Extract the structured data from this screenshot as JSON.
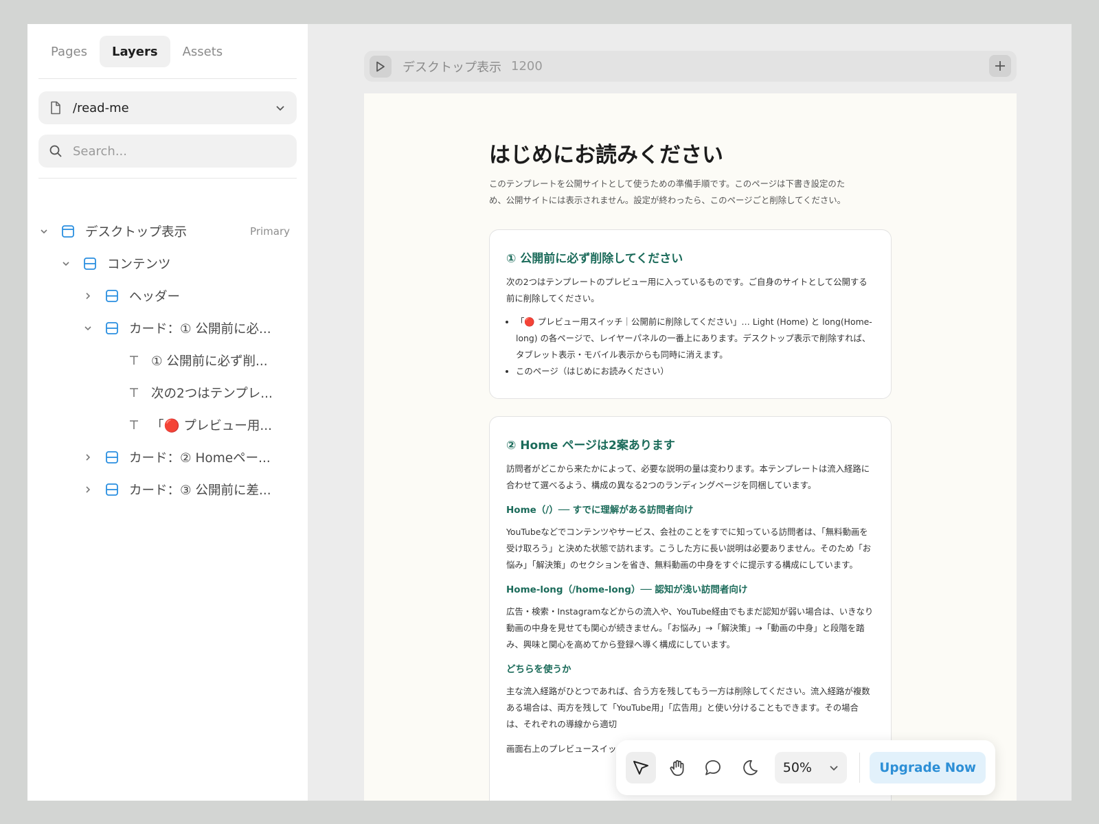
{
  "sidebar": {
    "tabs": [
      {
        "label": "Pages"
      },
      {
        "label": "Layers"
      },
      {
        "label": "Assets"
      }
    ],
    "page_select": {
      "value": "/read-me"
    },
    "search": {
      "placeholder": "Search..."
    },
    "tree": [
      {
        "label": "デスクトップ表示",
        "badge": "Primary"
      },
      {
        "label": "コンテンツ"
      },
      {
        "label": "ヘッダー"
      },
      {
        "label": "カード：① 公開前に必..."
      },
      {
        "label": "① 公開前に必ず削..."
      },
      {
        "label": "次の2つはテンプレ..."
      },
      {
        "label": "「🔴 プレビュー用..."
      },
      {
        "label": "カード：② Homeペー..."
      },
      {
        "label": "カード：③ 公開前に差..."
      }
    ]
  },
  "canvas_toolbar": {
    "frame_title": "デスクトップ表示",
    "frame_width": "1200"
  },
  "page": {
    "title": "はじめにお読みください",
    "intro": "このテンプレートを公開サイトとして使うための準備手順です。このページは下書き設定のため、公開サイトには表示されません。設定が終わったら、このページごと削除してください。",
    "card1": {
      "heading": "① 公開前に必ず削除してください",
      "body": "次の2つはテンプレートのプレビュー用に入っているものです。ご自身のサイトとして公開する前に削除してください。",
      "bullets": [
        "「🔴 プレビュー用スイッチ｜公開前に削除してください」… Light (Home) と long(Home-long) の各ページで、レイヤーパネルの一番上にあります。デスクトップ表示で削除すれば、タブレット表示・モバイル表示からも同時に消えます。",
        "このページ（はじめにお読みください）"
      ]
    },
    "card2": {
      "heading": "② Home ページは2案あります",
      "body1": "訪問者がどこから来たかによって、必要な説明の量は変わります。本テンプレートは流入経路に合わせて選べるよう、構成の異なる2つのランディングページを同梱しています。",
      "sub1": "Home（/）── すでに理解がある訪問者向け",
      "body2": "YouTubeなどでコンテンツやサービス、会社のことをすでに知っている訪問者は、「無料動画を受け取ろう」と決めた状態で訪れます。こうした方に長い説明は必要ありません。そのため「お悩み」「解決策」のセクションを省き、無料動画の中身をすぐに提示する構成にしています。",
      "sub2": "Home-long（/home-long）── 認知が浅い訪問者向け",
      "body3": "広告・検索・Instagramなどからの流入や、YouTube経由でもまだ認知が弱い場合は、いきなり動画の中身を見せても関心が続きません。「お悩み」→「解決策」→「動画の中身」と段階を踏み、興味と関心を高めてから登録へ導く構成にしています。",
      "sub3": "どちらを使うか",
      "body4": "主な流入経路がひとつであれば、合う方を残してもう一方は削除してください。流入経路が複数ある場合は、両方を残して「YouTube用」「広告用」と使い分けることもできます。その場合は、それぞれの導線から適切",
      "body5": "画面右上のプレビュースイッチ…使う場合も含め、公開前に必ず"
    }
  },
  "float_toolbar": {
    "tools": [
      "pointer",
      "hand",
      "comment",
      "moon"
    ],
    "zoom": "50%",
    "upgrade_label": "Upgrade Now"
  },
  "colors": {
    "accent_blue": "#2d8fd6",
    "heading_green": "#1b6b5a",
    "frame_icon_blue": "#2a8fe0"
  }
}
